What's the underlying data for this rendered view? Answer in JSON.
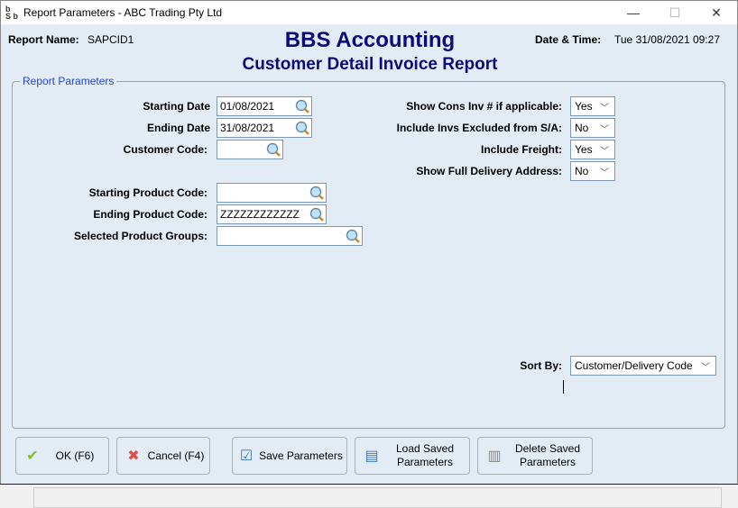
{
  "window": {
    "title": "Report Parameters - ABC Trading Pty Ltd",
    "minimize": "—",
    "maximize": "☐",
    "close": "✕"
  },
  "header": {
    "report_name_label": "Report Name:",
    "report_name": "SAPCID1",
    "app_title": "BBS Accounting",
    "report_title": "Customer Detail Invoice Report",
    "datetime_label": "Date & Time:",
    "datetime": "Tue 31/08/2021 09:27"
  },
  "group": {
    "legend": "Report Parameters"
  },
  "fields": {
    "starting_date": {
      "label": "Starting Date",
      "value": "01/08/2021"
    },
    "ending_date": {
      "label": "Ending Date",
      "value": "31/08/2021"
    },
    "customer_code": {
      "label": "Customer Code:",
      "value": ""
    },
    "starting_product_code": {
      "label": "Starting Product Code:",
      "value": ""
    },
    "ending_product_code": {
      "label": "Ending Product Code:",
      "value": "ZZZZZZZZZZZZ"
    },
    "selected_product_groups": {
      "label": "Selected Product Groups:",
      "value": ""
    }
  },
  "options": {
    "show_cons_inv": {
      "label": "Show Cons Inv # if applicable:",
      "value": "Yes"
    },
    "include_excluded": {
      "label": "Include Invs Excluded from S/A:",
      "value": "No"
    },
    "include_freight": {
      "label": "Include Freight:",
      "value": "Yes"
    },
    "show_full_delivery": {
      "label": "Show Full Delivery Address:",
      "value": "No"
    },
    "sort_by": {
      "label": "Sort By:",
      "value": "Customer/Delivery Code"
    }
  },
  "buttons": {
    "ok": "OK (F6)",
    "cancel": "Cancel (F4)",
    "save": "Save Parameters",
    "load": "Load Saved Parameters",
    "delete": "Delete Saved Parameters"
  },
  "colors": {
    "title_blue": "#0a0a7e",
    "legend_blue": "#2346d8",
    "background": "#e3ebf5"
  }
}
